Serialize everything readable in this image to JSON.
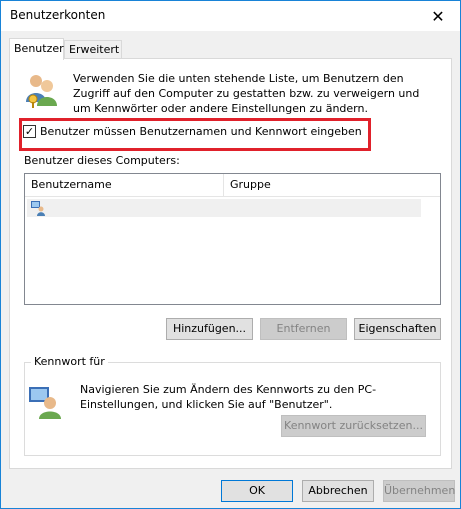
{
  "window": {
    "title": "Benutzerkonten"
  },
  "tabs": [
    {
      "label": "Benutzer"
    },
    {
      "label": "Erweitert"
    }
  ],
  "intro": {
    "text": "Verwenden Sie die unten stehende Liste, um Benutzern den Zugriff auf den Computer zu gestatten bzw. zu verweigern und um Kennwörter oder andere Einstellungen zu ändern."
  },
  "require_login": {
    "label": "Benutzer müssen Benutzernamen und Kennwort eingeben",
    "checked": true
  },
  "users_group": {
    "label": "Benutzer dieses Computers:",
    "columns": [
      "Benutzername",
      "Gruppe"
    ],
    "buttons": {
      "add": "Hinzufügen...",
      "remove": "Entfernen",
      "properties": "Eigenschaften"
    }
  },
  "password_group": {
    "title": "Kennwort für",
    "text": "Navigieren Sie zum Ändern des Kennworts zu den PC-Einstellungen, und klicken Sie auf \"Benutzer\".",
    "reset_button": "Kennwort zurücksetzen..."
  },
  "footer": {
    "ok": "OK",
    "cancel": "Abbrechen",
    "apply": "Übernehmen"
  },
  "colors": {
    "accent": "#1883d7",
    "highlight_border": "#e0212b"
  },
  "icons": {
    "close": "close-icon",
    "users": "users-icon",
    "user_row": "user-icon",
    "password": "password-user-icon"
  }
}
